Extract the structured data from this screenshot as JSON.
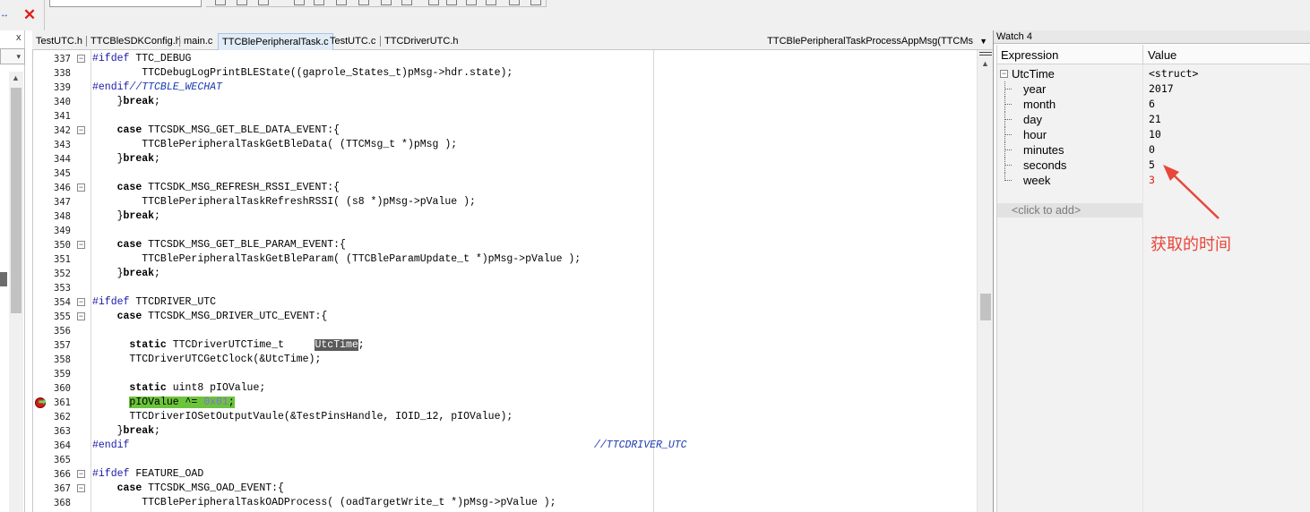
{
  "window": {
    "combo_text": "",
    "close_icon": "close-icon"
  },
  "left_panel": {
    "close_label": "x"
  },
  "tabs": [
    {
      "label": "TestUTC.h"
    },
    {
      "label": "TTCBleSDKConfig.h"
    },
    {
      "label": "main.c"
    },
    {
      "label": "TTCBlePeripheralTask.c",
      "active": true
    },
    {
      "label": "TestUTC.c"
    },
    {
      "label": "TTCDriverUTC.h"
    }
  ],
  "function_combo": "TTCBlePeripheralTaskProcessAppMsg(TTCMs",
  "code_lines": [
    {
      "num": "337",
      "fold": true
    },
    {
      "num": "338"
    },
    {
      "num": "339"
    },
    {
      "num": "340"
    },
    {
      "num": "341"
    },
    {
      "num": "342",
      "fold": true
    },
    {
      "num": "343"
    },
    {
      "num": "344"
    },
    {
      "num": "345"
    },
    {
      "num": "346",
      "fold": true
    },
    {
      "num": "347"
    },
    {
      "num": "348"
    },
    {
      "num": "349"
    },
    {
      "num": "350",
      "fold": true
    },
    {
      "num": "351"
    },
    {
      "num": "352"
    },
    {
      "num": "353"
    },
    {
      "num": "354",
      "fold": true
    },
    {
      "num": "355",
      "fold": true
    },
    {
      "num": "356"
    },
    {
      "num": "357"
    },
    {
      "num": "358"
    },
    {
      "num": "359"
    },
    {
      "num": "360"
    },
    {
      "num": "361",
      "breakpoint": true
    },
    {
      "num": "362"
    },
    {
      "num": "363"
    },
    {
      "num": "364"
    },
    {
      "num": "365"
    },
    {
      "num": "366",
      "fold": true
    },
    {
      "num": "367",
      "fold": true
    },
    {
      "num": "368"
    }
  ],
  "code": {
    "l337_pp": "#ifdef",
    "l337_rest": " TTC_DEBUG",
    "l338": "        TTCDebugLogPrintBLEState((gaprole_States_t)pMsg->hdr.state);",
    "l339_pp": "#endif",
    "l339_cmt": "//TTCBLE_WECHAT",
    "l340_brace": "    }",
    "l340_kw": "break",
    "l340_semi": ";",
    "l342_kw": "case",
    "l342_rest": " TTCSDK_MSG_GET_BLE_DATA_EVENT:{",
    "l343": "        TTCBlePeripheralTaskGetBleData( (TTCMsg_t *)pMsg );",
    "l344_brace": "    }",
    "l344_kw": "break",
    "l344_semi": ";",
    "l346_kw": "case",
    "l346_rest": " TTCSDK_MSG_REFRESH_RSSI_EVENT:{",
    "l347": "        TTCBlePeripheralTaskRefreshRSSI( (s8 *)pMsg->pValue );",
    "l348_brace": "    }",
    "l348_kw": "break",
    "l348_semi": ";",
    "l350_kw": "case",
    "l350_rest": " TTCSDK_MSG_GET_BLE_PARAM_EVENT:{",
    "l351": "        TTCBlePeripheralTaskGetBleParam( (TTCBleParamUpdate_t *)pMsg->pValue );",
    "l352_brace": "    }",
    "l352_kw": "break",
    "l352_semi": ";",
    "l354_pp": "#ifdef",
    "l354_rest": " TTCDRIVER_UTC",
    "l355_kw": "case",
    "l355_rest": " TTCSDK_MSG_DRIVER_UTC_EVENT:{",
    "l357_kw": "static",
    "l357_mid": " TTCDriverUTCTime_t     ",
    "l357_sel": "UtcTime",
    "l357_semi": ";",
    "l358": "      TTCDriverUTCGetClock(&UtcTime);",
    "l360_kw": "static",
    "l360_rest": " uint8 pIOValue;",
    "l361_a": "pIOValue ^= ",
    "l361_num": "0x01",
    "l361_semi": ";",
    "l362": "      TTCDriverIOSetOutputVaule(&TestPinsHandle, IOID_12, pIOValue);",
    "l363_brace": "    }",
    "l363_kw": "break",
    "l363_semi": ";",
    "l364_pp": "#endif",
    "l364_cmt": "//TTCDRIVER_UTC",
    "l366_pp": "#ifdef",
    "l366_rest": " FEATURE_OAD",
    "l367_kw": "case",
    "l367_rest": " TTCSDK_MSG_OAD_EVENT:{",
    "l368": "        TTCBlePeripheralTaskOADProcess( (oadTargetWrite_t *)pMsg->pValue );"
  },
  "watch": {
    "title": "Watch 4",
    "col_expression": "Expression",
    "col_value": "Value",
    "root": {
      "name": "UtcTime",
      "value": "<struct>"
    },
    "items": [
      {
        "name": "year",
        "value": "2017"
      },
      {
        "name": "month",
        "value": "6"
      },
      {
        "name": "day",
        "value": "21"
      },
      {
        "name": "hour",
        "value": "10"
      },
      {
        "name": "minutes",
        "value": "0"
      },
      {
        "name": "seconds",
        "value": "5"
      },
      {
        "name": "week",
        "value": "3",
        "value_color": "#e0201a"
      }
    ],
    "add_placeholder": "<click to add>"
  },
  "annotation": {
    "text": "获取的时间",
    "color": "#e8473a"
  }
}
